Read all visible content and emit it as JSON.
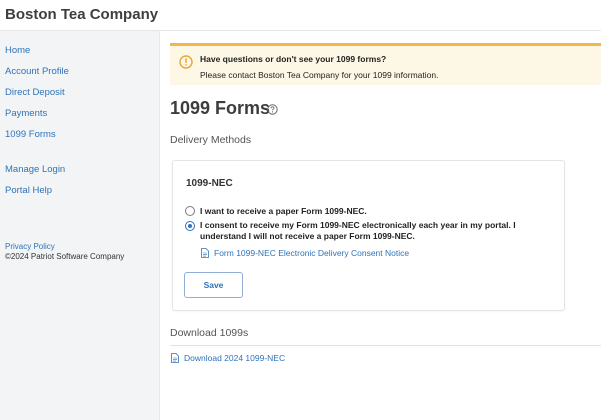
{
  "header": {
    "company_name": "Boston Tea Company"
  },
  "sidebar": {
    "items": [
      {
        "label": "Home"
      },
      {
        "label": "Account Profile"
      },
      {
        "label": "Direct Deposit"
      },
      {
        "label": "Payments"
      },
      {
        "label": "1099 Forms"
      },
      {
        "label": "Manage Login"
      },
      {
        "label": "Portal Help"
      }
    ],
    "privacy_label": "Privacy Policy",
    "copyright": "©2024 Patriot Software Company"
  },
  "alert": {
    "line1": "Have questions or don't see your 1099 forms?",
    "line2": "Please contact Boston Tea Company for your 1099 information.",
    "icon": "warning-icon",
    "accent_color": "#f1b64e",
    "background_color": "#fdf7e6"
  },
  "main": {
    "title": "1099 Forms",
    "delivery_label": "Delivery Methods",
    "card": {
      "title": "1099-NEC",
      "options": [
        {
          "label": "I want to receive a paper Form 1099-NEC.",
          "selected": false
        },
        {
          "label_line1": "I consent to receive my Form 1099-NEC electronically each year in my portal. I",
          "label_line2": "understand I will not receive a paper Form 1099-NEC.",
          "selected": true
        }
      ],
      "consent_link": "Form 1099-NEC Electronic Delivery Consent Notice",
      "save_label": "Save"
    },
    "download_label": "Download 1099s",
    "download_link": "Download 2024 1099-NEC"
  },
  "colors": {
    "link": "#2f73b8",
    "sidebar_bg": "#f3f4f6"
  }
}
